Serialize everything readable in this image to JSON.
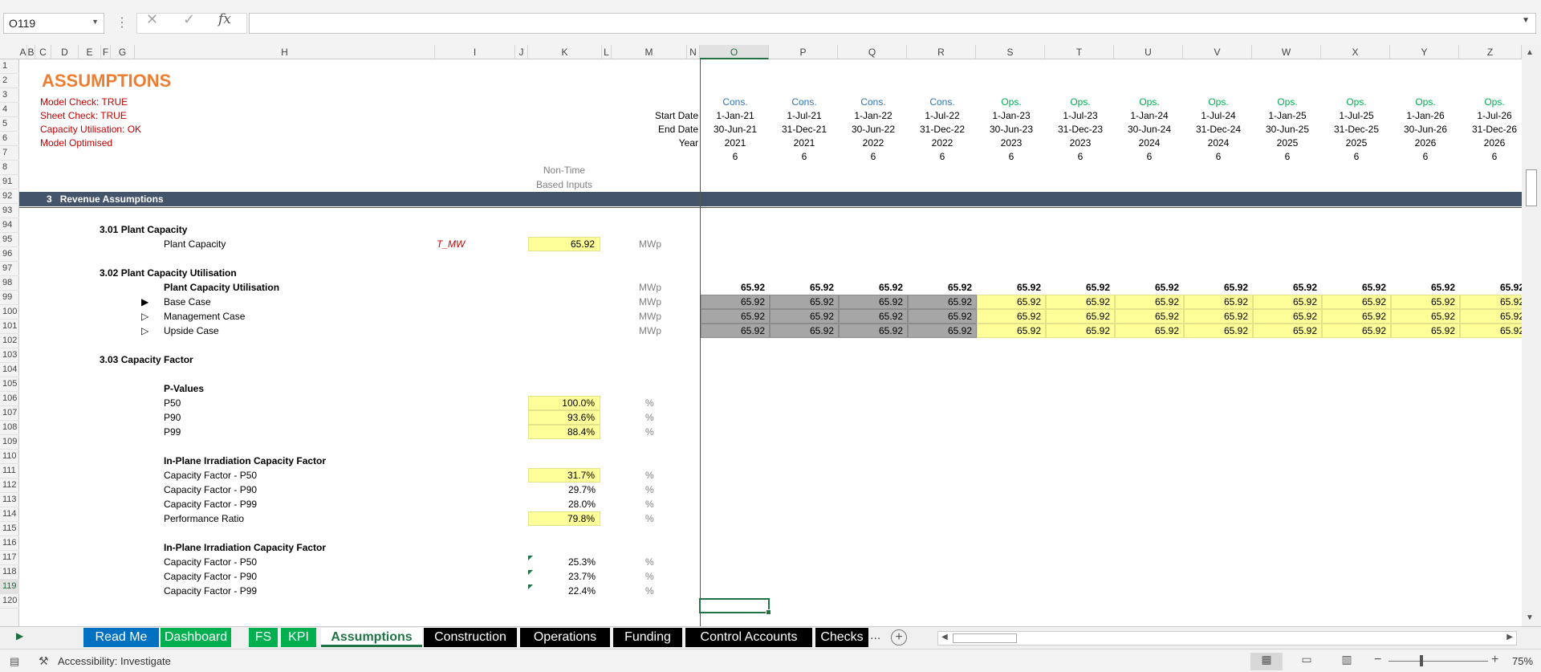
{
  "formula_bar": {
    "name_box": "O119",
    "fx": "fx"
  },
  "columns": [
    "A",
    "B",
    "C",
    "D",
    "E",
    "F",
    "G",
    "H",
    "I",
    "J",
    "K",
    "L",
    "M",
    "N",
    "O",
    "P",
    "Q",
    "R",
    "S",
    "T",
    "U",
    "V",
    "W",
    "X",
    "Y",
    "Z"
  ],
  "rows": [
    "1",
    "2",
    "3",
    "4",
    "5",
    "6",
    "7",
    "8",
    "91",
    "92",
    "93",
    "94",
    "95",
    "96",
    "97",
    "98",
    "99",
    "100",
    "101",
    "102",
    "103",
    "104",
    "105",
    "106",
    "107",
    "108",
    "109",
    "110",
    "111",
    "112",
    "113",
    "114",
    "115",
    "116",
    "117",
    "118",
    "119",
    "120"
  ],
  "sheet": {
    "title": "ASSUMPTIONS",
    "checks": [
      "Model Check: TRUE",
      "Sheet Check: TRUE",
      "Capacity Utilisation: OK",
      "Model Optimised"
    ],
    "row_labels": {
      "start": "Start Date",
      "end": "End Date",
      "year": "Year"
    },
    "non_time": [
      "Non-Time",
      "Based Inputs"
    ],
    "timeline": [
      {
        "phase": "Cons.",
        "start": "1-Jan-21",
        "end": "30-Jun-21",
        "year": "2021",
        "n": "6"
      },
      {
        "phase": "Cons.",
        "start": "1-Jul-21",
        "end": "31-Dec-21",
        "year": "2021",
        "n": "6"
      },
      {
        "phase": "Cons.",
        "start": "1-Jan-22",
        "end": "30-Jun-22",
        "year": "2022",
        "n": "6"
      },
      {
        "phase": "Cons.",
        "start": "1-Jul-22",
        "end": "31-Dec-22",
        "year": "2022",
        "n": "6"
      },
      {
        "phase": "Ops.",
        "start": "1-Jan-23",
        "end": "30-Jun-23",
        "year": "2023",
        "n": "6"
      },
      {
        "phase": "Ops.",
        "start": "1-Jul-23",
        "end": "31-Dec-23",
        "year": "2023",
        "n": "6"
      },
      {
        "phase": "Ops.",
        "start": "1-Jan-24",
        "end": "30-Jun-24",
        "year": "2024",
        "n": "6"
      },
      {
        "phase": "Ops.",
        "start": "1-Jul-24",
        "end": "31-Dec-24",
        "year": "2024",
        "n": "6"
      },
      {
        "phase": "Ops.",
        "start": "1-Jan-25",
        "end": "30-Jun-25",
        "year": "2025",
        "n": "6"
      },
      {
        "phase": "Ops.",
        "start": "1-Jul-25",
        "end": "31-Dec-25",
        "year": "2025",
        "n": "6"
      },
      {
        "phase": "Ops.",
        "start": "1-Jan-26",
        "end": "30-Jun-26",
        "year": "2026",
        "n": "6"
      },
      {
        "phase": "Ops.",
        "start": "1-Jul-26",
        "end": "31-Dec-26",
        "year": "2026",
        "n": "6"
      }
    ],
    "section": {
      "num": "3",
      "title": "Revenue Assumptions"
    },
    "s301": {
      "head": "3.01 Plant Capacity",
      "label": "Plant Capacity",
      "name": "T_MW",
      "value": "65.92",
      "unit": "MWp"
    },
    "s302": {
      "head": "3.02 Plant Capacity Utilisation",
      "label": "Plant Capacity Utilisation",
      "cases": [
        {
          "label": "Base Case",
          "marker": "▶"
        },
        {
          "label": "Management Case",
          "marker": "▷"
        },
        {
          "label": "Upside Case",
          "marker": "▷"
        }
      ],
      "unit": "MWp",
      "value": "65.92"
    },
    "s303": {
      "head": "3.03 Capacity Factor",
      "pvalues_head": "P-Values",
      "pvalues": [
        {
          "label": "P50",
          "value": "100.0%",
          "unit": "%"
        },
        {
          "label": "P90",
          "value": "93.6%",
          "unit": "%"
        },
        {
          "label": "P99",
          "value": "88.4%",
          "unit": "%"
        }
      ],
      "inplane_head": "In-Plane Irradiation Capacity Factor",
      "inplane": [
        {
          "label": "Capacity Factor - P50",
          "value": "31.7%",
          "unit": "%"
        },
        {
          "label": "Capacity Factor - P90",
          "value": "29.7%",
          "unit": "%"
        },
        {
          "label": "Capacity Factor - P99",
          "value": "28.0%",
          "unit": "%"
        }
      ],
      "pr_label": "Performance Ratio",
      "pr_value": "79.8%",
      "pr_unit": "%",
      "inplane2_head": "In-Plane Irradiation Capacity Factor",
      "inplane2": [
        {
          "label": "Capacity Factor - P50",
          "value": "25.3%",
          "unit": "%"
        },
        {
          "label": "Capacity Factor - P90",
          "value": "23.7%",
          "unit": "%"
        },
        {
          "label": "Capacity Factor - P99",
          "value": "22.4%",
          "unit": "%"
        }
      ]
    }
  },
  "tabs": [
    {
      "label": "Read Me",
      "color": "#0070c0"
    },
    {
      "label": "Dashboard",
      "color": "#00b050"
    },
    {
      "label": "FS",
      "color": "#00b050"
    },
    {
      "label": "KPI",
      "color": "#00b050"
    },
    {
      "label": "Assumptions",
      "active": true
    },
    {
      "label": "Construction",
      "color": "#000000"
    },
    {
      "label": "Operations",
      "color": "#000000"
    },
    {
      "label": "Funding",
      "color": "#000000"
    },
    {
      "label": "Control Accounts",
      "color": "#000000"
    },
    {
      "label": "Checks",
      "color": "#000000"
    }
  ],
  "tab_more": "...",
  "status": {
    "accessibility": "Accessibility: Investigate",
    "zoom": "75%"
  }
}
